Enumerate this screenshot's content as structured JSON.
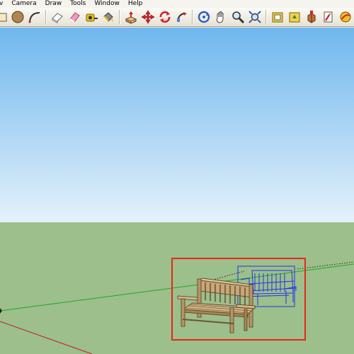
{
  "app": {
    "name": "SketchUp"
  },
  "menu": {
    "items": [
      {
        "label": "v"
      },
      {
        "label": "Camera"
      },
      {
        "label": "Draw"
      },
      {
        "label": "Tools"
      },
      {
        "label": "Window"
      },
      {
        "label": "Help"
      }
    ]
  },
  "toolbar": {
    "groups": [
      [
        "rectangle-icon",
        "circle-icon",
        "arc-icon"
      ],
      [
        "eraser-3d-icon",
        "eraser-icon",
        "tape-measure-icon",
        "paint-bucket-icon"
      ],
      [
        "push-pull-icon",
        "move-icon",
        "rotate-icon",
        "follow-me-icon"
      ],
      [
        "orbit-icon",
        "pan-icon",
        "zoom-icon",
        "zoom-extents-icon"
      ],
      [
        "get-models-icon",
        "share-model-icon",
        "components-icon",
        "styles-icon",
        "extension-icon"
      ]
    ]
  },
  "scene": {
    "sky_top_color": "#6fb7ee",
    "sky_bottom_color": "#e4f1fb",
    "ground_color": "#9cbf8b",
    "selection_box_color": "#e8261c",
    "selected_component_color": "#2233ee",
    "bench_wood_color": "#c9a777",
    "bench_dark_color": "#5e4a30"
  }
}
